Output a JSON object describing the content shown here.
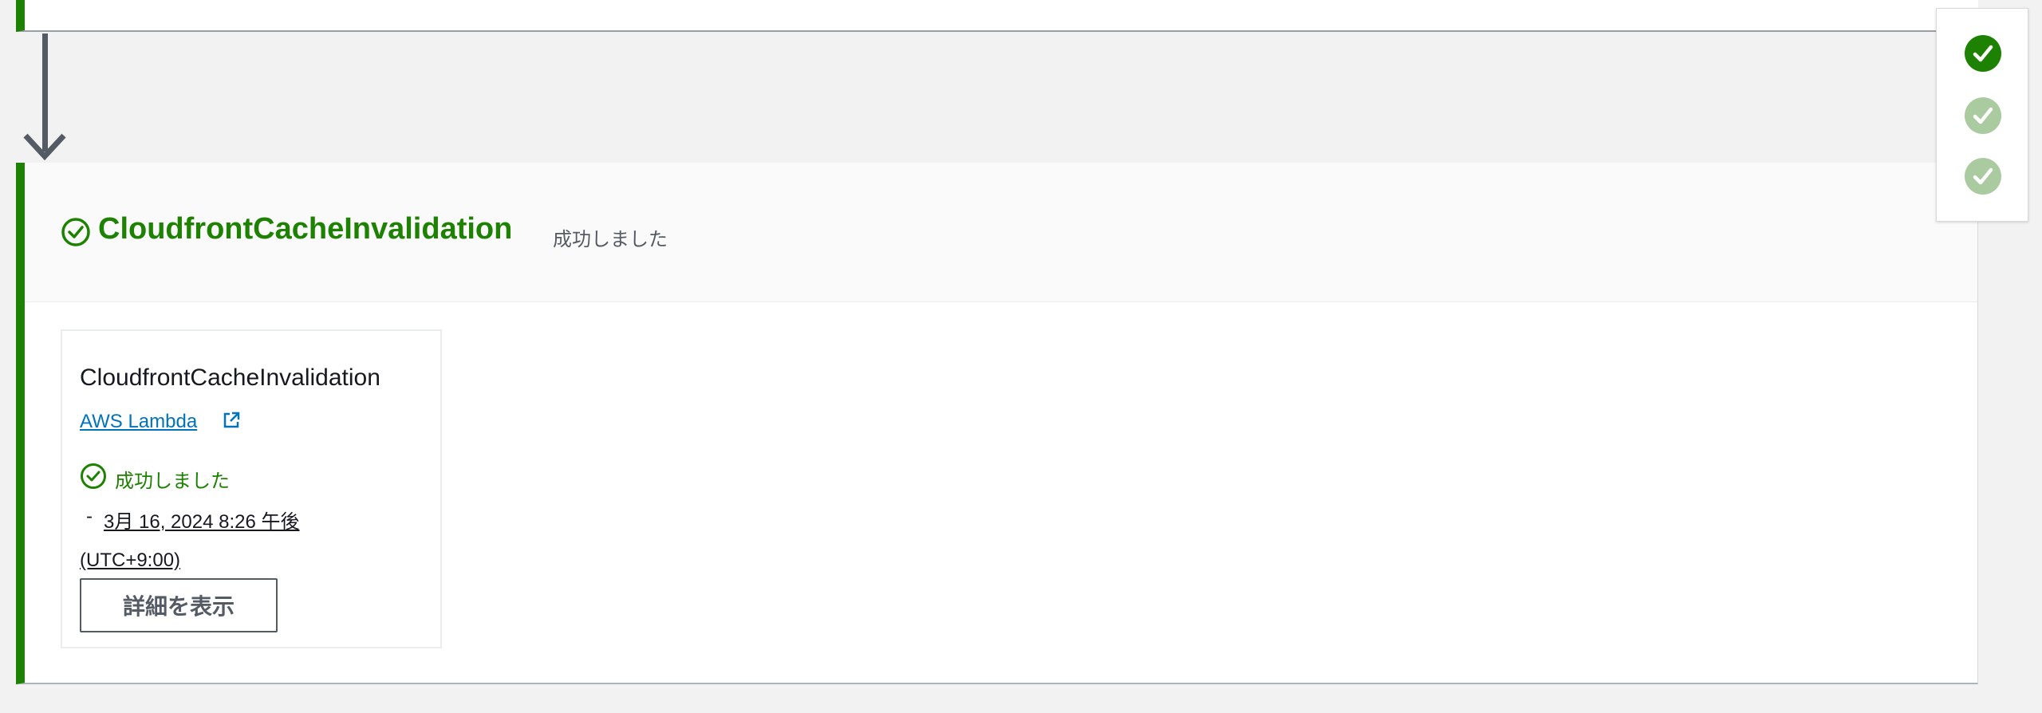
{
  "stage": {
    "name": "CloudfrontCacheInvalidation",
    "status_text": "成功しました",
    "status_icon": "check-circle-icon",
    "accent_color": "#1d8102"
  },
  "action": {
    "name": "CloudfrontCacheInvalidation",
    "provider": "AWS Lambda",
    "provider_icon": "external-link-icon",
    "status_text": "成功しました",
    "timestamp_dash": "-",
    "timestamp": "3月 16, 2024 8:26 午後 (UTC+9:00)",
    "details_button": "詳細を表示"
  },
  "stage_nav": {
    "items": [
      {
        "state": "current",
        "icon": "check-circle-icon",
        "color": "#1d8102"
      },
      {
        "state": "succeeded",
        "icon": "check-circle-icon",
        "color": "#aacba0"
      },
      {
        "state": "succeeded",
        "icon": "check-circle-icon",
        "color": "#aacba0"
      }
    ]
  }
}
